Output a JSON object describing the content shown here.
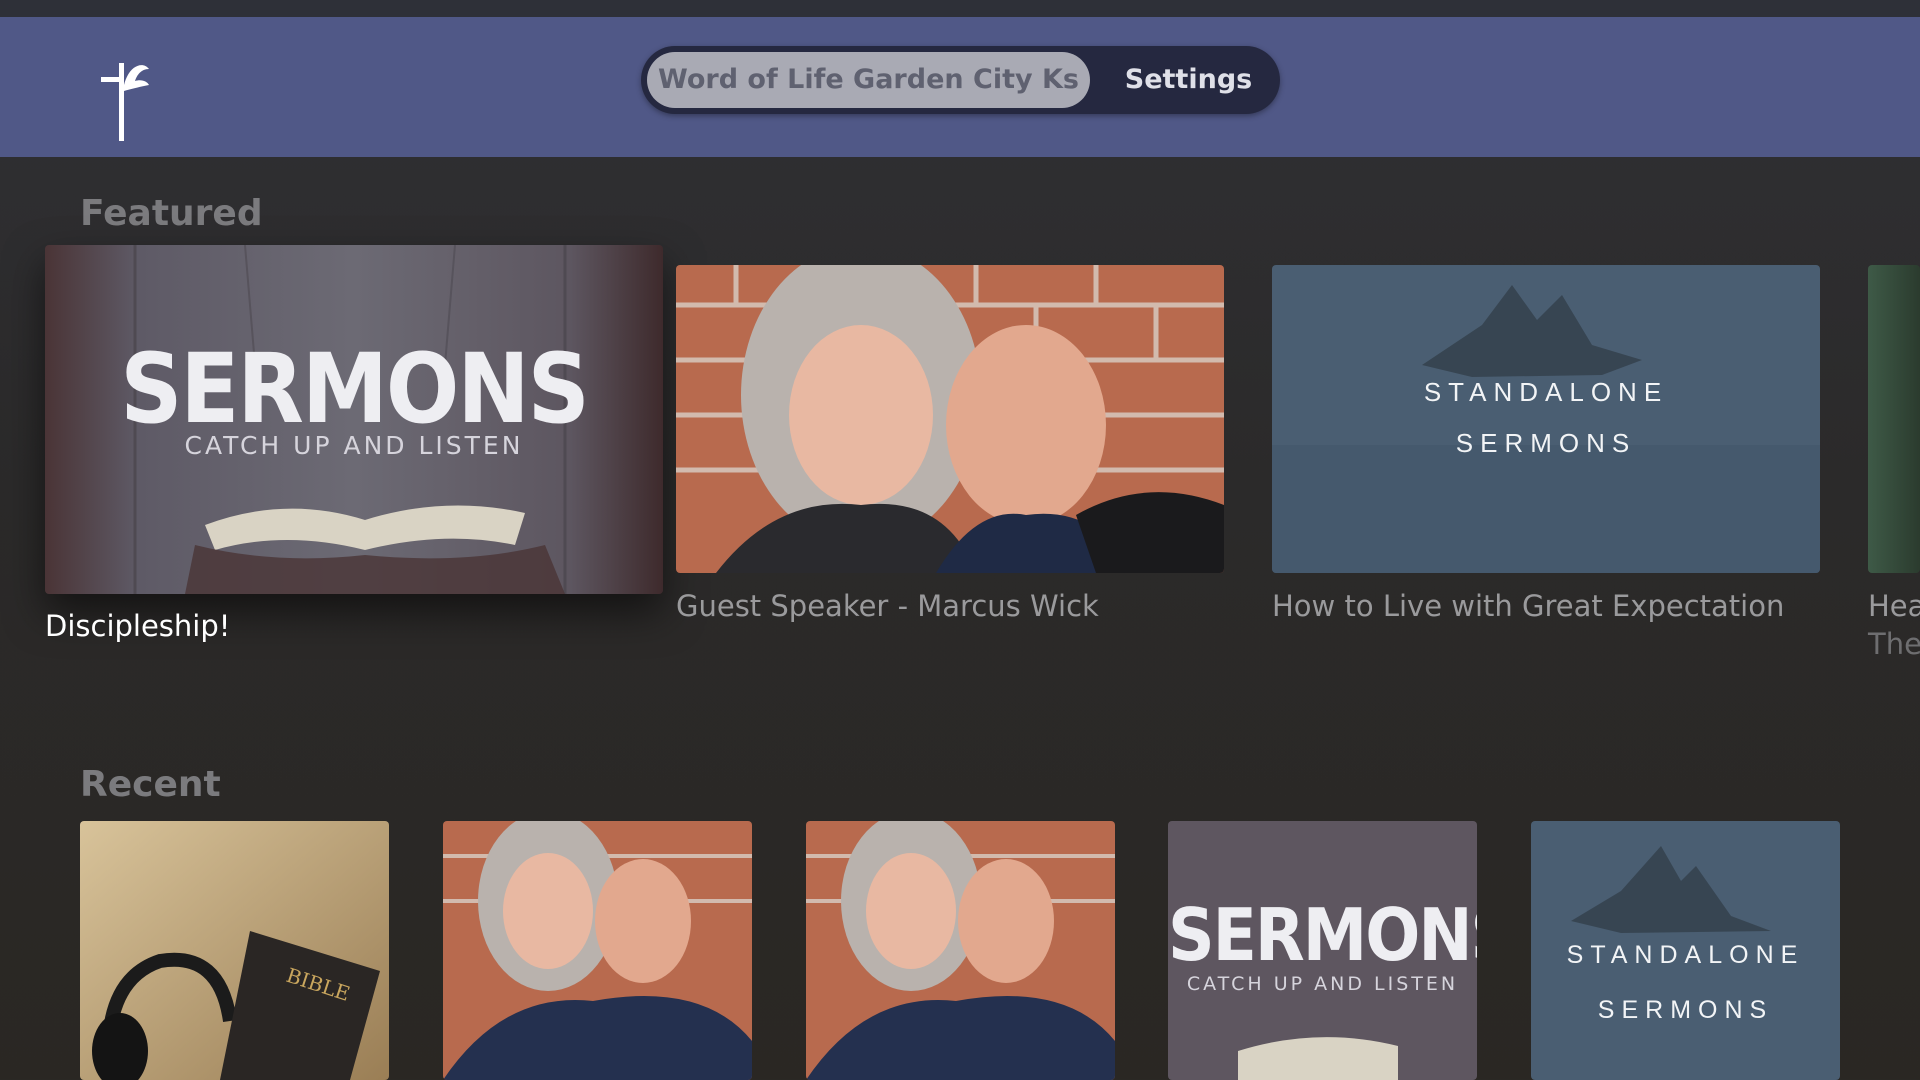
{
  "header": {
    "tabs": [
      {
        "label": "Word of Life Garden City Ks",
        "selected": true
      },
      {
        "label": "Settings",
        "selected": false
      }
    ]
  },
  "featured": {
    "title": "Featured",
    "items": [
      {
        "title": "Discipleship!",
        "art_heading": "SERMONS",
        "art_sub": "CATCH UP AND LISTEN",
        "focused": true
      },
      {
        "title": "Guest Speaker - Marcus Wick"
      },
      {
        "title": "How to Live with Great Expectation",
        "art_line1": "STANDALONE",
        "art_line2": "SERMONS"
      },
      {
        "title_line1": "Hea",
        "title_line2": "The"
      }
    ]
  },
  "recent": {
    "title": "Recent",
    "items": [
      {
        "art_text": "BIBLE"
      },
      {},
      {},
      {
        "art_heading": "SERMONS",
        "art_sub": "CATCH UP AND LISTEN"
      },
      {
        "art_line1": "STANDALONE",
        "art_line2": "SERMONS"
      }
    ]
  },
  "colors": {
    "header_bg": "#505887",
    "page_bg": "#2b2a2a",
    "segment_bg": "#252840",
    "segment_selected_bg": "#a9aab4"
  }
}
